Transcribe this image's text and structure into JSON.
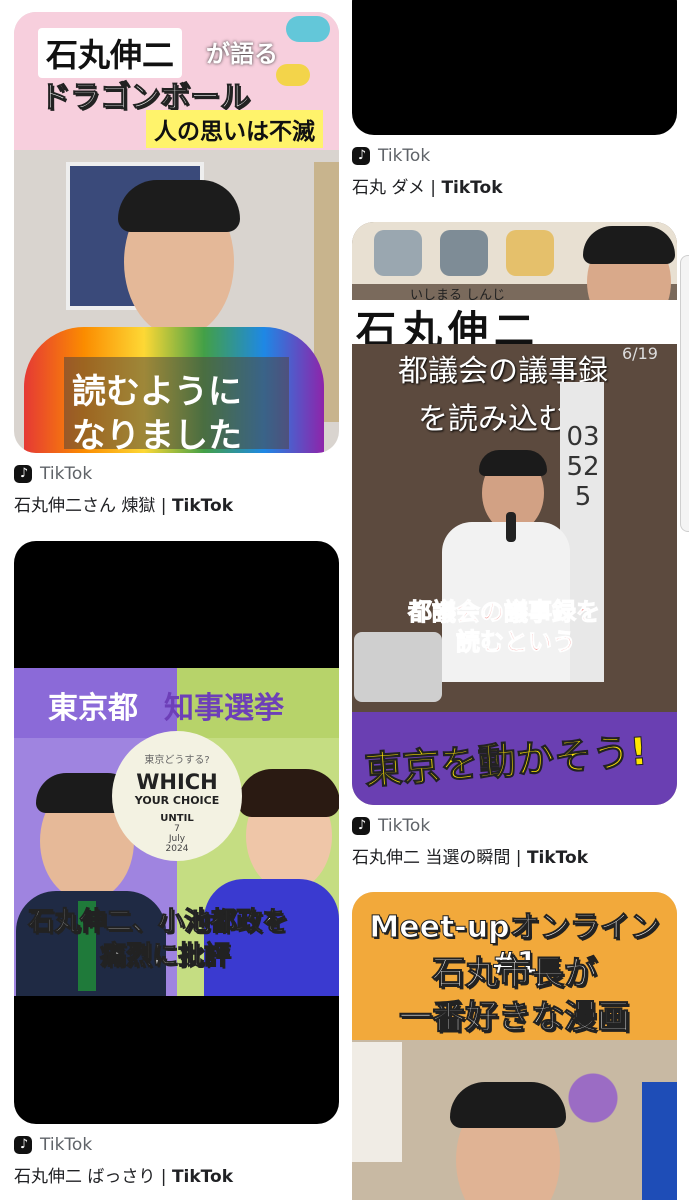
{
  "results": [
    {
      "source": "TikTok",
      "title_prefix": "石丸伸二さん 煉獄",
      "separator": " | ",
      "site": "TikTok",
      "overlay": {
        "line1": "石丸伸二",
        "line1b": "が語る",
        "line2": "ドラゴンボール",
        "line3": "人の思いは不滅",
        "caption1": "読むように",
        "caption2": "なりました"
      }
    },
    {
      "source": "TikTok",
      "title_prefix": "石丸伸二 ばっさり",
      "separator": " | ",
      "site": "TikTok",
      "overlay": {
        "header_left": "東京都",
        "header_right": "知事選挙",
        "badge_small": "東京どうする?",
        "badge_which": "WHICH",
        "badge_choice": "YOUR CHOICE",
        "badge_until": "UNTIL",
        "badge_date": "7\nJuly\n2024",
        "caption1": "石丸伸二、小池都政を",
        "caption2": "痛烈に批評"
      }
    },
    {
      "source": "TikTok",
      "title_prefix": "石丸 ダメ",
      "separator": " | ",
      "site": "TikTok"
    },
    {
      "source": "TikTok",
      "title_prefix": "石丸伸二 当選の瞬間",
      "separator": " | ",
      "site": "TikTok",
      "overlay": {
        "name": "石丸伸二",
        "ruby": "いしまる しんじ",
        "date": "6/19",
        "line1": "都議会の議事録",
        "line2": "を読み込む?",
        "red1": "都議会の議事録を",
        "red2": "読むという",
        "banner": "東京を動かそう!",
        "pole": "03 525"
      }
    },
    {
      "source": "",
      "title_prefix": "",
      "separator": "",
      "site": "",
      "overlay": {
        "line1": "Meet-upオンライン#1",
        "line2": "石丸市長が",
        "line3": "一番好きな漫画"
      }
    }
  ],
  "colors": {
    "caption_text": "#202124",
    "source_text": "#5f6368",
    "pink_band": "#f4c6d6",
    "purple": "#8b6ad8",
    "lime": "#b7d36a",
    "banner_purple": "#6a3fb2",
    "banner_yellow": "#ffe600",
    "meetup_orange": "#f2a93b"
  }
}
